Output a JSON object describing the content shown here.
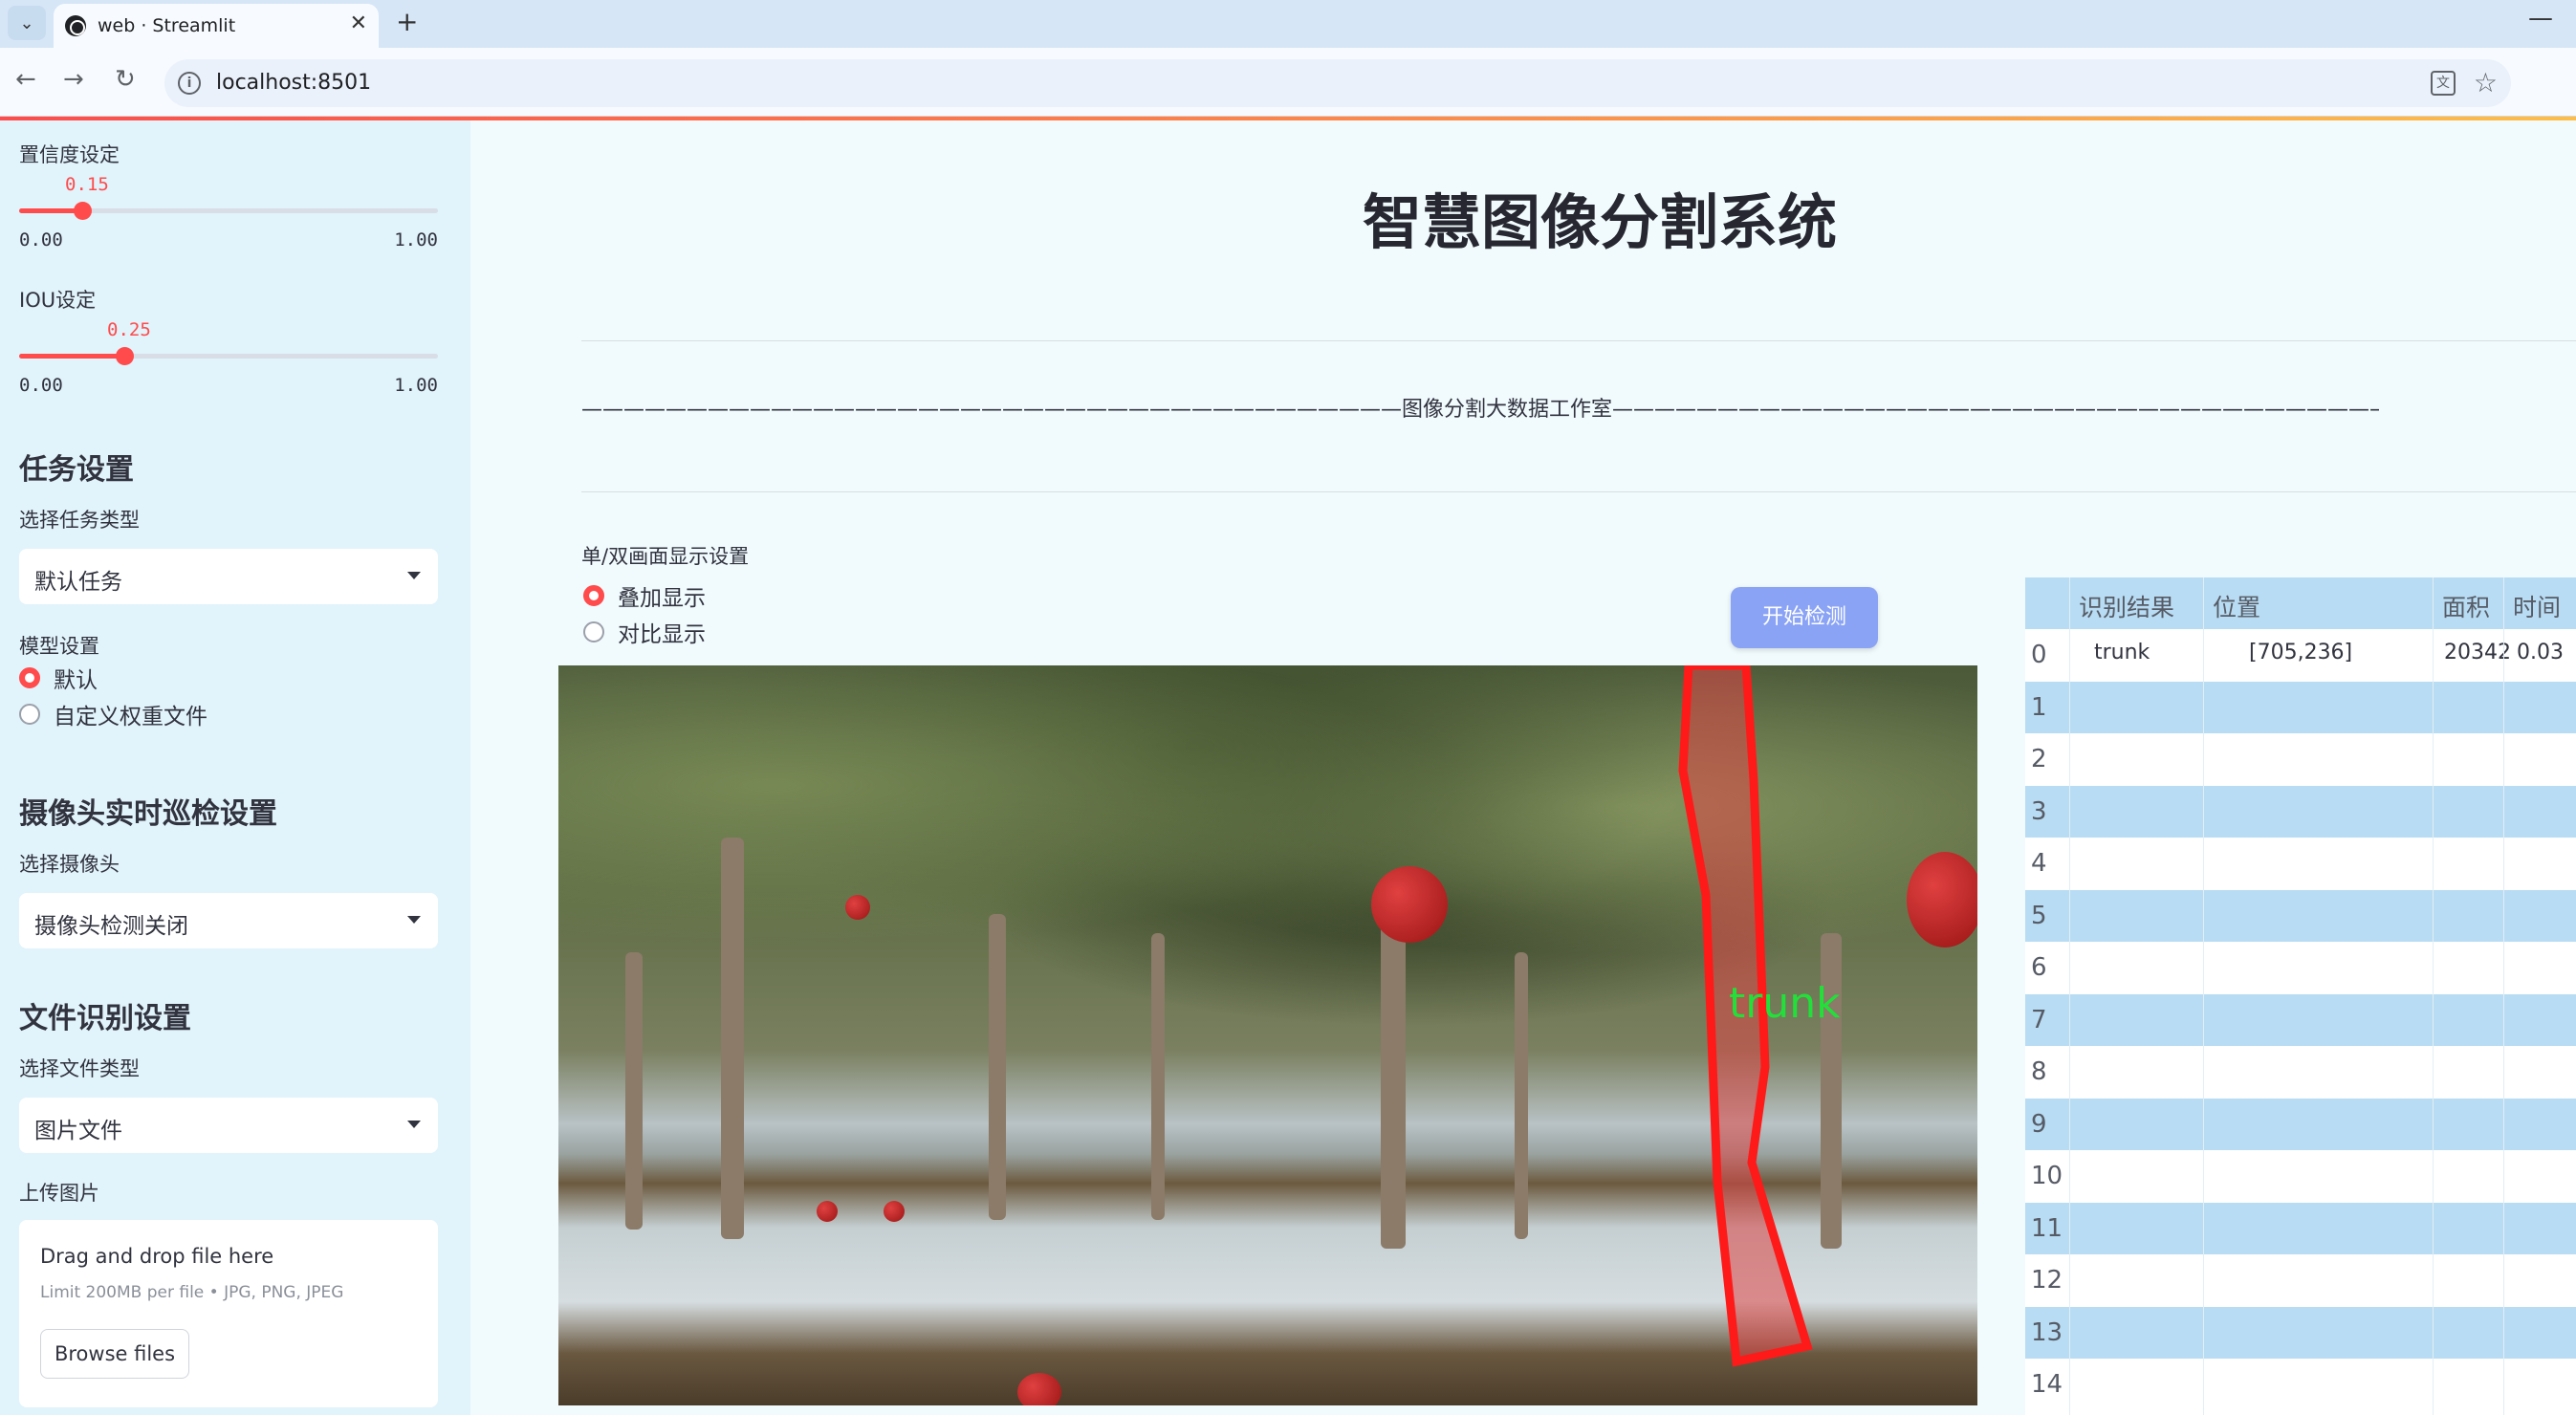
{
  "browser": {
    "tab_title": "web · Streamlit",
    "url": "localhost:8501"
  },
  "sidebar": {
    "confidence": {
      "label": "置信度设定",
      "value": "0.15",
      "min": "0.00",
      "max": "1.00",
      "fraction": 0.15
    },
    "iou": {
      "label": "IOU设定",
      "value": "0.25",
      "min": "0.00",
      "max": "1.00",
      "fraction": 0.25
    },
    "task_heading": "任务设置",
    "task_type_label": "选择任务类型",
    "task_type_value": "默认任务",
    "model_label": "模型设置",
    "model_options": [
      "默认",
      "自定义权重文件"
    ],
    "model_selected": 0,
    "camera_heading": "摄像头实时巡检设置",
    "camera_label": "选择摄像头",
    "camera_value": "摄像头检测关闭",
    "file_heading": "文件识别设置",
    "file_type_label": "选择文件类型",
    "file_type_value": "图片文件",
    "upload_label": "上传图片",
    "upload": {
      "title": "Drag and drop file here",
      "limit": "Limit 200MB per file • JPG, PNG, JPEG",
      "browse": "Browse files"
    }
  },
  "main": {
    "title": "智慧图像分割系统",
    "subtitle_line": "———————————————————————————————————————图像分割大数据工作室———————————————————————————————————————",
    "display_label": "单/双画面显示设置",
    "display_options": [
      "叠加显示",
      "对比显示"
    ],
    "display_selected": 0,
    "start_button": "开始检测",
    "detection_label": "trunk"
  },
  "colors": {
    "accent": "#ff4b4b",
    "button": "#8aa3f5",
    "table_stripe": "#b8dcf3",
    "mask": "#ff1a1a",
    "label_text": "#22e03a"
  },
  "table": {
    "headers": [
      "识别结果",
      "位置",
      "面积",
      "时间"
    ],
    "rows": [
      {
        "idx": "0",
        "result": "trunk",
        "position": "[705,236]",
        "area": "20342",
        "time": "0.03"
      },
      {
        "idx": "1",
        "result": "",
        "position": "",
        "area": "",
        "time": ""
      },
      {
        "idx": "2",
        "result": "",
        "position": "",
        "area": "",
        "time": ""
      },
      {
        "idx": "3",
        "result": "",
        "position": "",
        "area": "",
        "time": ""
      },
      {
        "idx": "4",
        "result": "",
        "position": "",
        "area": "",
        "time": ""
      },
      {
        "idx": "5",
        "result": "",
        "position": "",
        "area": "",
        "time": ""
      },
      {
        "idx": "6",
        "result": "",
        "position": "",
        "area": "",
        "time": ""
      },
      {
        "idx": "7",
        "result": "",
        "position": "",
        "area": "",
        "time": ""
      },
      {
        "idx": "8",
        "result": "",
        "position": "",
        "area": "",
        "time": ""
      },
      {
        "idx": "9",
        "result": "",
        "position": "",
        "area": "",
        "time": ""
      },
      {
        "idx": "10",
        "result": "",
        "position": "",
        "area": "",
        "time": ""
      },
      {
        "idx": "11",
        "result": "",
        "position": "",
        "area": "",
        "time": ""
      },
      {
        "idx": "12",
        "result": "",
        "position": "",
        "area": "",
        "time": ""
      },
      {
        "idx": "13",
        "result": "",
        "position": "",
        "area": "",
        "time": ""
      },
      {
        "idx": "14",
        "result": "",
        "position": "",
        "area": "",
        "time": ""
      }
    ]
  }
}
